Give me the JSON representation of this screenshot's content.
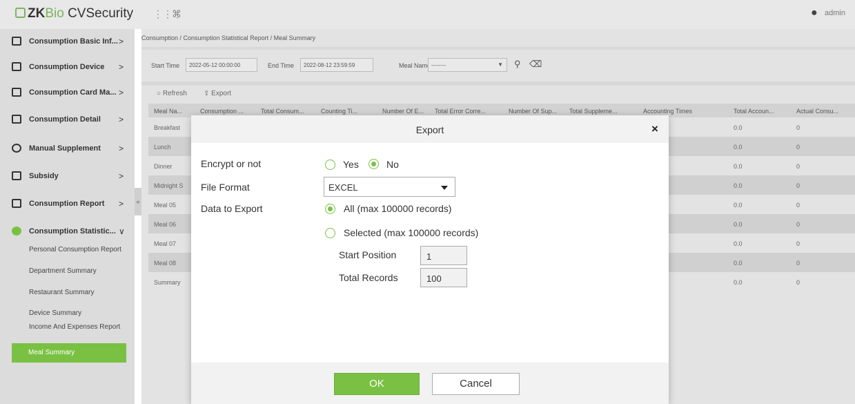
{
  "app": {
    "logo_zk": "ZK",
    "logo_bio": "Bio",
    "logo_rest": " CVSecurity",
    "user_name": "admin"
  },
  "sidebar": {
    "items": [
      {
        "label": "Consumption Basic Inf...",
        "arrow": ">"
      },
      {
        "label": "Consumption Device",
        "arrow": ">"
      },
      {
        "label": "Consumption Card Ma...",
        "arrow": ">"
      },
      {
        "label": "Consumption Detail",
        "arrow": ">"
      },
      {
        "label": "Manual Supplement",
        "arrow": ">"
      },
      {
        "label": "Subsidy",
        "arrow": ">"
      },
      {
        "label": "Consumption Report",
        "arrow": ">"
      },
      {
        "label": "Consumption Statistic...",
        "arrow": "∨"
      }
    ],
    "sub_items": [
      "Personal Consumption Report",
      "Department Summary",
      "Restaurant Summary",
      "Device Summary",
      "Income And Expenses Report",
      "Meal Summary"
    ],
    "collapse": "«"
  },
  "breadcrumb": "Consumption / Consumption Statistical Report / Meal Summary",
  "filter": {
    "start_label": "Start Time",
    "start_value": "2022-05-12 00:00:00",
    "end_label": "End Time",
    "end_value": "2022-08-12 23:59:59",
    "meal_label": "Meal Name",
    "meal_value": "--------"
  },
  "toolbar": {
    "refresh": "Refresh",
    "export": "Export"
  },
  "table": {
    "headers": [
      "Meal Na...",
      "Consumption ...",
      "Total Consum...",
      "Counting Ti...",
      "Number Of E...",
      "Total Error Corre...",
      "Number Of Sup...",
      "Total Suppleme...",
      "Accounting Times",
      "Total Accoun...",
      "Actual Consu..."
    ],
    "rows": [
      {
        "name": "Breakfast",
        "total_account": "0.0",
        "actual": "0"
      },
      {
        "name": "Lunch",
        "total_account": "0.0",
        "actual": "0"
      },
      {
        "name": "Dinner",
        "total_account": "0.0",
        "actual": "0"
      },
      {
        "name": "Midnight S",
        "total_account": "0.0",
        "actual": "0"
      },
      {
        "name": "Meal 05",
        "total_account": "0.0",
        "actual": "0"
      },
      {
        "name": "Meal 06",
        "total_account": "0.0",
        "actual": "0"
      },
      {
        "name": "Meal 07",
        "total_account": "0.0",
        "actual": "0"
      },
      {
        "name": "Meal 08",
        "total_account": "0.0",
        "actual": "0"
      },
      {
        "name": "Summary",
        "total_account": "0.0",
        "actual": "0"
      }
    ]
  },
  "modal": {
    "title": "Export",
    "close": "×",
    "encrypt_label": "Encrypt or not",
    "encrypt_yes": "Yes",
    "encrypt_no": "No",
    "encrypt_selected": "No",
    "format_label": "File Format",
    "format_value": "EXCEL",
    "data_label": "Data to Export",
    "option_all": "All (max 100000 records)",
    "option_selected": "Selected (max 100000 records)",
    "data_selected": "All",
    "start_position_label": "Start Position",
    "start_position_value": "1",
    "total_records_label": "Total Records",
    "total_records_value": "100",
    "ok": "OK",
    "cancel": "Cancel"
  },
  "colors": {
    "accent": "#7ac143",
    "brand": "#7ab55c"
  }
}
